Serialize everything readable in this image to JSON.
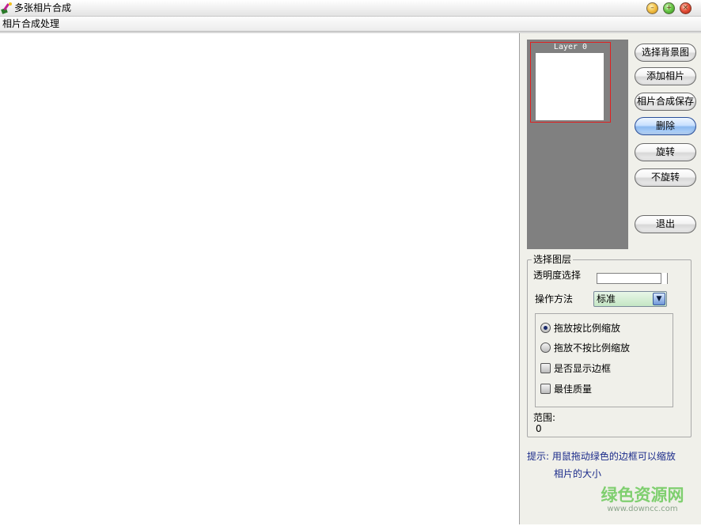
{
  "window": {
    "title": "多张相片合成",
    "icon": "paint-brush-icon",
    "controls": {
      "minimize_icon": "minimize-icon",
      "maximize_icon": "maximize-icon",
      "close_icon": "close-icon"
    }
  },
  "menu": {
    "items": [
      {
        "label": "相片合成处理"
      }
    ]
  },
  "layers_panel": {
    "items": [
      {
        "label": "Layer 0"
      }
    ]
  },
  "actions": {
    "select_background": "选择背景图",
    "add_photo": "添加相片",
    "save_composite": "相片合成保存",
    "delete": "删除",
    "rotate": "旋转",
    "no_rotate": "不旋转",
    "exit": "退出"
  },
  "layer_settings": {
    "group_title": "选择图层",
    "opacity_label": "透明度选择",
    "opacity_value": 1.0,
    "method_label": "操作方法",
    "method_value": "标准",
    "options": [
      {
        "type": "radio",
        "label": "拖放按比例缩放",
        "checked": true
      },
      {
        "type": "radio",
        "label": "拖放不按比例缩放",
        "checked": false
      },
      {
        "type": "checkbox",
        "label": "是否显示边框",
        "checked": false
      },
      {
        "type": "checkbox",
        "label": "最佳质量",
        "checked": false
      }
    ],
    "range_label": "范围:",
    "range_value": "0"
  },
  "hint": {
    "line1": "提示: 用鼠拖动绿色的边框可以缩放",
    "line2": "相片的大小"
  },
  "watermark": {
    "main": "绿色资源网",
    "sub": "www.downcc.com"
  },
  "colors": {
    "layer_list_bg": "#808080",
    "selected_layer_border": "#e02020",
    "hint_text": "#1a2a8a",
    "watermark": "#7fcf6f"
  }
}
